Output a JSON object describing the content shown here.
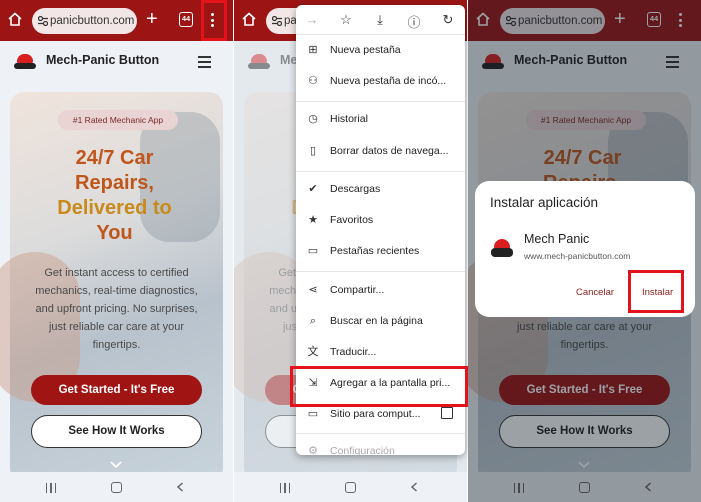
{
  "chrome": {
    "url": "panicbutton.com",
    "tab_count": "44",
    "plus": "+"
  },
  "site": {
    "name": "Mech-Panic Button",
    "badge": "#1 Rated Mechanic App",
    "headline_lines": [
      "24/7 Car",
      "Repairs,",
      "Delivered to",
      "You"
    ],
    "description": "Get instant access to certified mechanics, real-time diagnostics, and upfront pricing. No surprises, just reliable car care at your fingertips.",
    "primary_button": "Get Started - It's Free",
    "secondary_button": "See How It Works"
  },
  "menu": {
    "items": [
      {
        "label": "Nueva pestaña",
        "icon": "plus-square-icon"
      },
      {
        "label": "Nueva pestaña de incó...",
        "icon": "incognito-icon"
      },
      {
        "label": "Historial",
        "icon": "history-icon"
      },
      {
        "label": "Borrar datos de navega...",
        "icon": "trash-icon"
      },
      {
        "label": "Descargas",
        "icon": "download-check-icon"
      },
      {
        "label": "Favoritos",
        "icon": "star-icon"
      },
      {
        "label": "Pestañas recientes",
        "icon": "devices-icon"
      },
      {
        "label": "Compartir...",
        "icon": "share-icon"
      },
      {
        "label": "Buscar en la página",
        "icon": "find-in-page-icon"
      },
      {
        "label": "Traducir...",
        "icon": "translate-icon"
      },
      {
        "label": "Agregar a la pantalla pri...",
        "icon": "add-to-home-icon"
      },
      {
        "label": "Sitio para comput...",
        "icon": "desktop-icon"
      },
      {
        "label": "Configuración",
        "icon": "settings-icon"
      }
    ]
  },
  "dialog": {
    "title": "Instalar aplicación",
    "app_name": "Mech Panic",
    "app_url": "www.mech-panicbutton.com",
    "cancel": "Cancelar",
    "install": "Instalar"
  },
  "colors": {
    "chrome_bar": "#9c1414",
    "accent_red": "#a01414",
    "highlight_box": "#e3121b",
    "headline_orange": "#c1561b"
  }
}
